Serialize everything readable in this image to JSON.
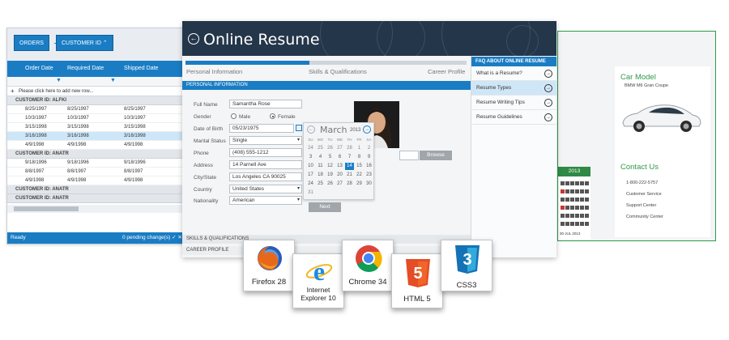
{
  "grid": {
    "toolbar": {
      "orders_label": "ORDERS",
      "customer_label": "CUSTOMER ID ⌃"
    },
    "columns": [
      "Order Date",
      "Required Date",
      "Shipped Date"
    ],
    "add_row_text": "Please click here to add new row...",
    "groups": [
      {
        "label": "CUSTOMER ID: ALFKI",
        "rows": [
          [
            "8/25/1997",
            "8/25/1997",
            "8/25/1997"
          ],
          [
            "10/3/1997",
            "10/3/1997",
            "10/3/1997"
          ],
          [
            "3/15/1998",
            "3/15/1998",
            "3/15/1998"
          ],
          [
            "3/16/1998",
            "3/16/1998",
            "3/16/1998"
          ],
          [
            "4/9/1998",
            "4/9/1998",
            "4/9/1998"
          ]
        ]
      },
      {
        "label": "CUSTOMER ID: ANATR",
        "rows": [
          [
            "9/18/1996",
            "9/18/1996",
            "9/18/1996"
          ],
          [
            "8/8/1997",
            "8/8/1997",
            "8/8/1997"
          ],
          [
            "4/9/1998",
            "4/9/1998",
            "4/9/1998"
          ]
        ]
      }
    ],
    "collapsed_groups": [
      "CUSTOMER ID: ANATR",
      "CUSTOMER ID: ANATR"
    ],
    "status_left": "Ready",
    "status_right": "0 pending change(s) ✓ ✕"
  },
  "resume": {
    "title": "Online Resume",
    "progress": 0.44,
    "steps": [
      "Personal Information",
      "Skills & Qualifications",
      "Career Profile"
    ],
    "section_title": "PERSONAL INFORMATION",
    "fields": {
      "full_name_label": "Full Name",
      "full_name": "Samantha Rose",
      "gender_label": "Gender",
      "male": "Male",
      "female": "Female",
      "dob_label": "Date of Birth",
      "dob": "05/23/1975",
      "marital_label": "Marital Status",
      "marital": "Single",
      "phone_label": "Phone",
      "phone": "(408) 555-1212",
      "address_label": "Address",
      "address": "14 Parnell Ave",
      "city_label": "City/State",
      "city": "Los Angeles CA 90025",
      "country_label": "Country",
      "country": "United States",
      "nationality_label": "Nationality",
      "nationality": "American"
    },
    "calendar": {
      "month": "March",
      "year": "2013",
      "weekdays": [
        "SU",
        "MO",
        "TU",
        "WE",
        "TH",
        "FR",
        "SA"
      ],
      "weeks": [
        [
          "24",
          "25",
          "26",
          "27",
          "28",
          "1",
          "2"
        ],
        [
          "3",
          "4",
          "5",
          "6",
          "7",
          "8",
          "9"
        ],
        [
          "10",
          "11",
          "12",
          "13",
          "14",
          "15",
          "16"
        ],
        [
          "17",
          "18",
          "19",
          "20",
          "21",
          "22",
          "23"
        ],
        [
          "24",
          "25",
          "26",
          "27",
          "28",
          "29",
          "30"
        ],
        [
          "31",
          "",
          "",
          "",
          "",
          "",
          ""
        ]
      ]
    },
    "browse_label": "Browse",
    "next_label": "Next",
    "collapsed_sections": [
      "SKILLS & QUALIFICATIONS",
      "CAREER PROFILE"
    ],
    "faq": {
      "title": "FAQ ABOUT ONLINE RESUME",
      "items": [
        "What is a Resume?",
        "Resume Types",
        "Resume Writing Tips",
        "Resume Guidelines"
      ],
      "selected_index": 1
    }
  },
  "car": {
    "title": "Car Model",
    "model": "BMW M6 Gran Coupe",
    "contact_title": "Contact Us",
    "contact_items": [
      "1-800-222-5757",
      "Customer Service",
      "Support Center",
      "Community Center"
    ],
    "calendar_year": "2013",
    "calendar_footer": "30 JUL 2013"
  },
  "badges": [
    {
      "name": "firefox",
      "label": "Firefox 28"
    },
    {
      "name": "ie",
      "label": "Internet Explorer 10"
    },
    {
      "name": "chrome",
      "label": "Chrome 34"
    },
    {
      "name": "html5",
      "label": "HTML 5"
    },
    {
      "name": "css3",
      "label": "CSS3"
    }
  ],
  "colors": {
    "accent": "#1a7dc4",
    "dark_header": "#24364a",
    "green": "#2f9a4b"
  }
}
